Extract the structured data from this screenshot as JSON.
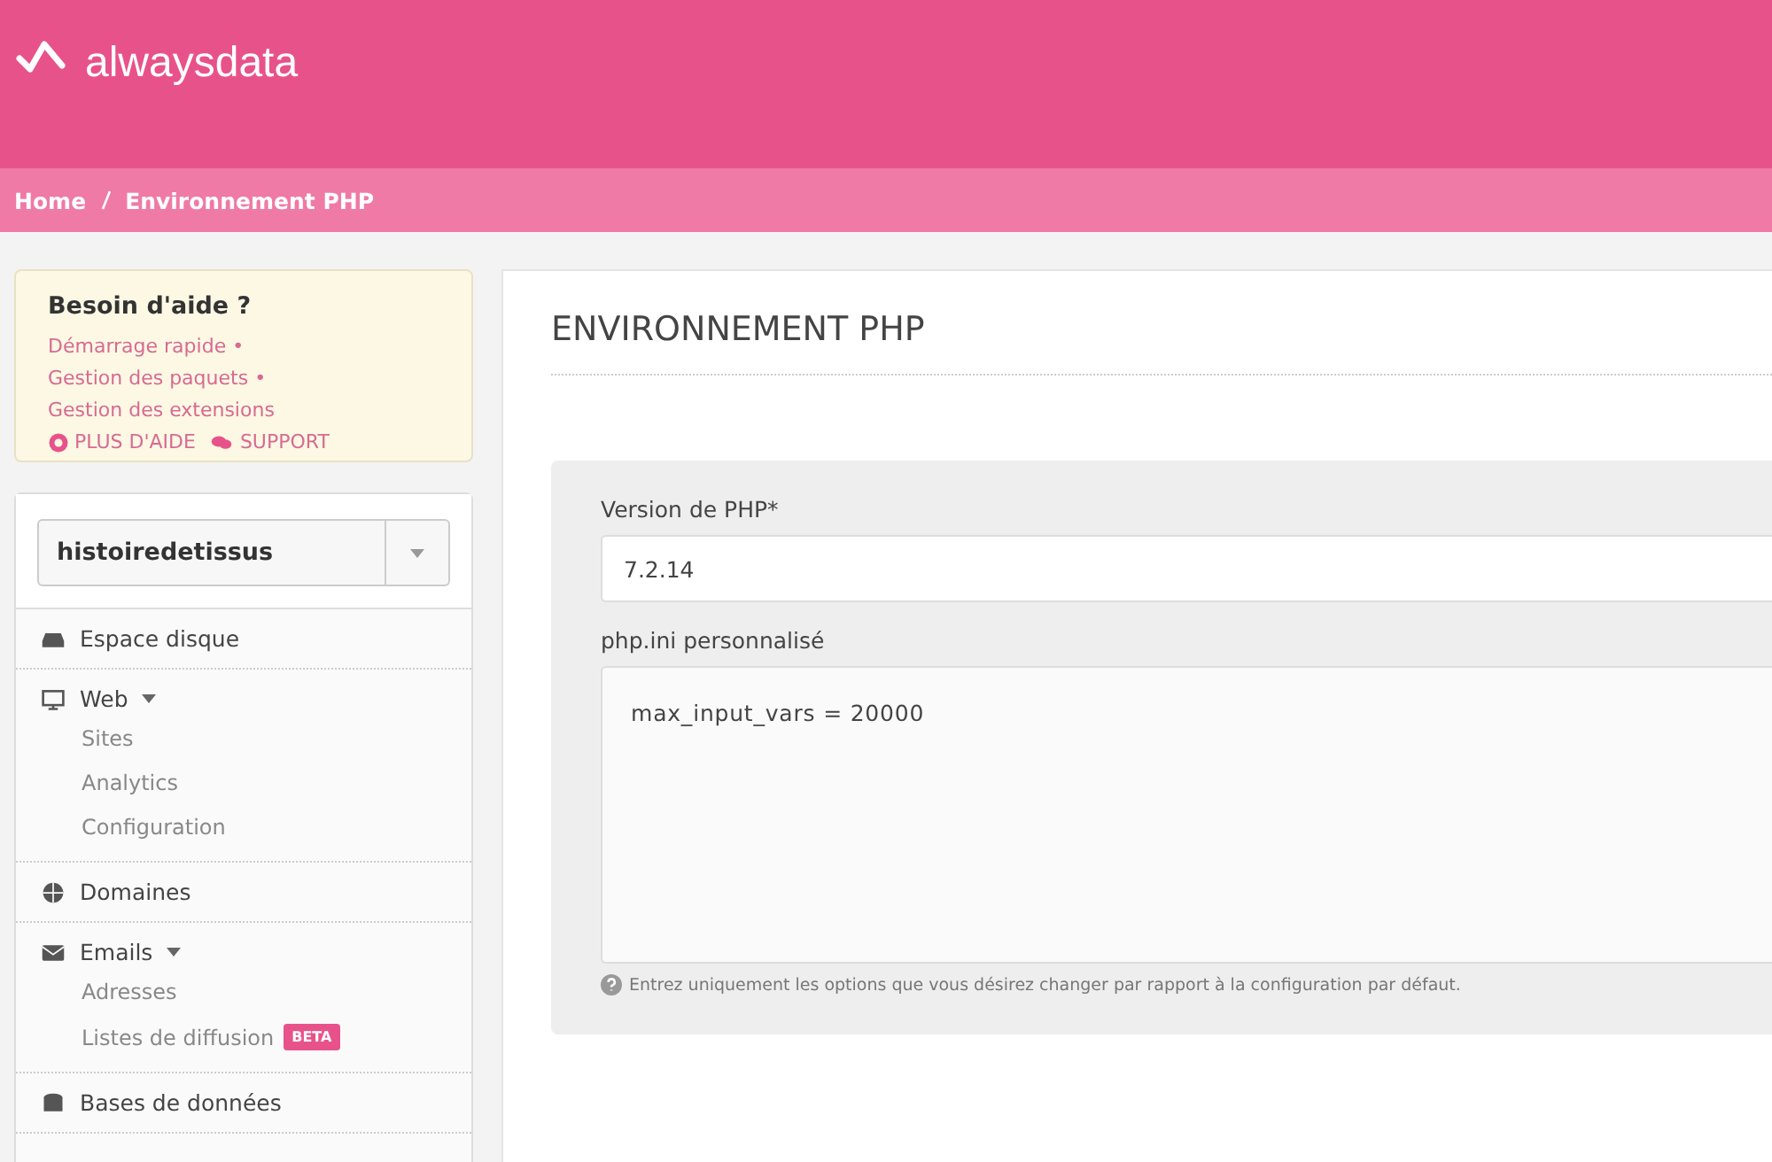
{
  "brand": {
    "name": "alwaysdata"
  },
  "breadcrumb": [
    "Home",
    "Environnement PHP"
  ],
  "help": {
    "title": "Besoin d'aide ?",
    "links": [
      "Démarrage rapide",
      "Gestion des paquets",
      "Gestion des extensions"
    ],
    "separator": "•",
    "actions": [
      {
        "kind": "lifebuoy",
        "label": "PLUS D'AIDE"
      },
      {
        "kind": "chat",
        "label": "SUPPORT"
      }
    ]
  },
  "account_select": {
    "value": "histoiredetissus"
  },
  "nav": [
    {
      "kind": "disk",
      "label": "Espace disque"
    },
    {
      "kind": "monitor",
      "label": "Web",
      "children": [
        {
          "label": "Sites"
        },
        {
          "label": "Analytics"
        },
        {
          "label": "Configuration"
        }
      ]
    },
    {
      "kind": "globe",
      "label": "Domaines"
    },
    {
      "kind": "envelope",
      "label": "Emails",
      "children": [
        {
          "label": "Adresses"
        },
        {
          "label": "Listes de diffusion",
          "badge": "BETA"
        }
      ]
    },
    {
      "kind": "database",
      "label": "Bases de données"
    }
  ],
  "page_title": "ENVIRONNEMENT PHP",
  "form": {
    "version_label": "Version de PHP*",
    "version_value": "7.2.14",
    "ini_label": "php.ini personnalisé",
    "ini_value": "max_input_vars = 20000",
    "help_text": "Entrez uniquement les options que vous désirez changer par rapport à la configuration par défaut."
  }
}
